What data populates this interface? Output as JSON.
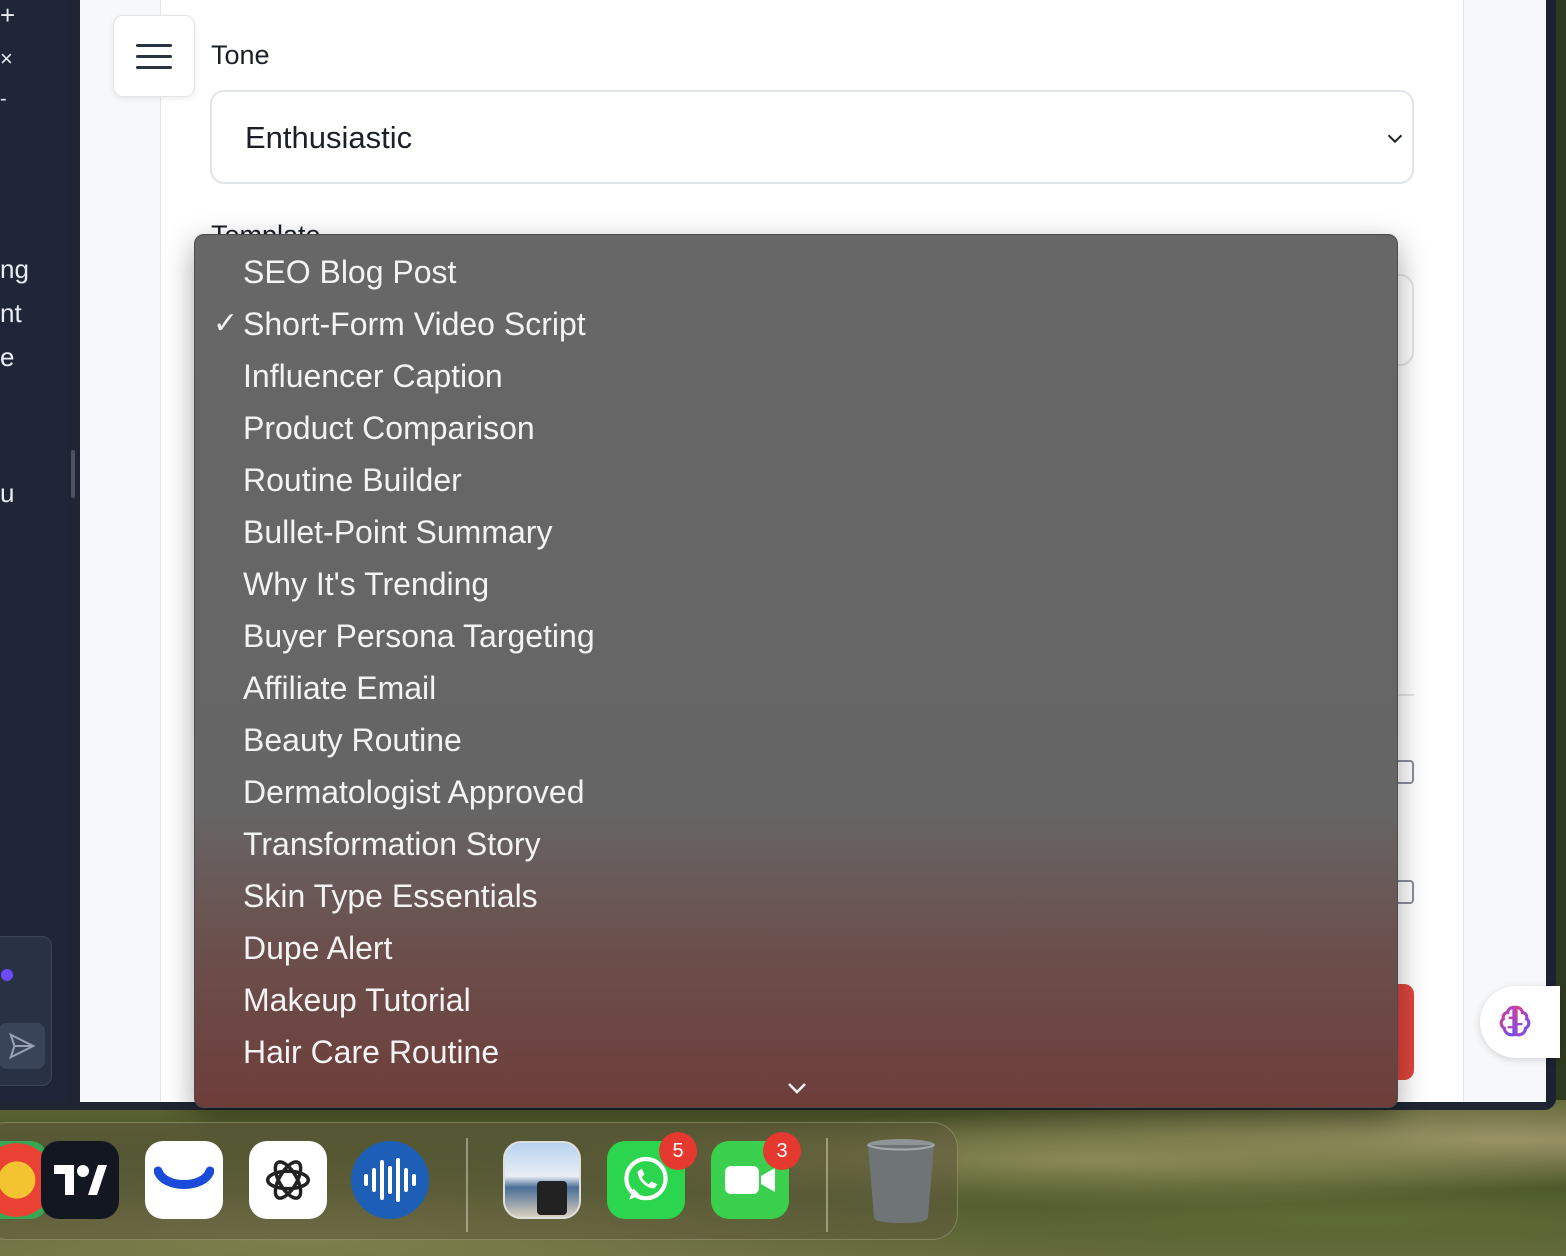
{
  "sidebar": {
    "fragments": [
      "+",
      "×",
      "-",
      "ng",
      "nt",
      "e",
      "u"
    ]
  },
  "form": {
    "tone_label": "Tone",
    "tone_value": "Enthusiastic",
    "template_label": "Template"
  },
  "dropdown": {
    "selected": "Short-Form Video Script",
    "check_glyph": "✓",
    "options": [
      "SEO Blog Post",
      "Short-Form Video Script",
      "Influencer Caption",
      "Product Comparison",
      "Routine Builder",
      "Bullet-Point Summary",
      "Why It's Trending",
      "Buyer Persona Targeting",
      "Affiliate Email",
      "Beauty Routine",
      "Dermatologist Approved",
      "Transformation Story",
      "Skin Type Essentials",
      "Dupe Alert",
      "Makeup Tutorial",
      "Hair Care Routine"
    ]
  },
  "dock": {
    "apps": [
      {
        "name": "chrome-icon"
      },
      {
        "name": "tradingview-icon"
      },
      {
        "name": "dock-app-blue-icon"
      },
      {
        "name": "chatgpt-icon"
      },
      {
        "name": "voice-app-icon"
      },
      {
        "name": "preview-icon"
      },
      {
        "name": "whatsapp-icon",
        "badge": "5"
      },
      {
        "name": "facetime-icon",
        "badge": "3"
      },
      {
        "name": "trash-icon"
      }
    ]
  },
  "colors": {
    "dropdown_bg": "#666565",
    "accent_red": "#e0443e",
    "badge_red": "#e5382f",
    "sidebar_bg": "#1e2638"
  }
}
